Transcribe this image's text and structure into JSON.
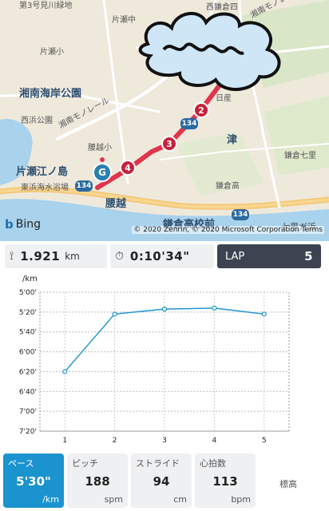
{
  "map": {
    "labels": {
      "katase_ryokuchi": "第3号見川緑地",
      "katase_naka": "片瀬中",
      "katase_sho": "片瀬小",
      "nishikamakura": "西鎌倉四",
      "shonan_park": "湘南海岸公園",
      "nishiike": "西浜公園",
      "monorail": "湘南モノレール",
      "monorail2": "湘南モノレール",
      "koshigoe_sho": "腰越小",
      "katase_enoshima": "片瀬江ノ島",
      "higashihama": "東浜海水浴場",
      "koshigoe": "腰越",
      "kamakura_ko": "鎌倉高",
      "kamakura_ko_mae": "鎌倉高校前",
      "tsu": "津",
      "kamakura_nanari": "鎌倉七里",
      "shichiri": "七里ガ浜",
      "nitta": "日産"
    },
    "route_badges": [
      "2",
      "3",
      "4"
    ],
    "goal_badge": "G",
    "road_shields": [
      "134",
      "134",
      "134"
    ],
    "bing_label": "Bing",
    "copyright": "© 2020 Zenrin, © 2020 Microsoft Corporation Terms"
  },
  "stats": {
    "distance_value": "1.921",
    "distance_unit": "km",
    "time_value": "0:10'34\"",
    "lap_label": "LAP",
    "lap_value": "5"
  },
  "chart_data": {
    "type": "line",
    "ylabel": "/km",
    "x": [
      1,
      2,
      3,
      4,
      5
    ],
    "xticks": [
      "1",
      "2",
      "3",
      "4",
      "5"
    ],
    "yticks": [
      "5'00'",
      "5'20'",
      "5'40'",
      "6'00'",
      "6'20'",
      "6'40'",
      "7'00'",
      "7'20'"
    ],
    "yticks_seconds": [
      300,
      320,
      340,
      360,
      380,
      400,
      420,
      440
    ],
    "ylim_seconds": [
      300,
      440
    ],
    "series": [
      {
        "values_seconds": [
          380,
          322,
          317,
          316,
          322
        ]
      }
    ],
    "line_color": "#1a93cf",
    "grid": true
  },
  "metrics": {
    "pace": {
      "label": "ペース",
      "value": "5'30\"",
      "unit": "/km"
    },
    "pitch": {
      "label": "ピッチ",
      "value": "188",
      "unit": "spm"
    },
    "stride": {
      "label": "ストライド",
      "value": "94",
      "unit": "cm"
    },
    "heart": {
      "label": "心拍数",
      "value": "113",
      "unit": "bpm"
    },
    "elevation": {
      "label": "標高"
    }
  },
  "colors": {
    "accent": "#1a93cf",
    "route": "#e0344d",
    "lap_bg": "#3b4450"
  }
}
